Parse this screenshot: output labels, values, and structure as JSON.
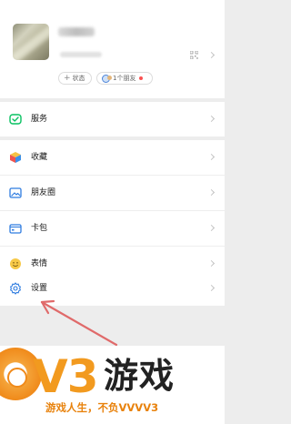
{
  "profile": {
    "status_label": "状态",
    "friends_label": "1个朋友"
  },
  "menu": {
    "services": "服务",
    "favorites": "收藏",
    "moments": "朋友圈",
    "cards": "卡包",
    "stickers": "表情",
    "settings": "设置"
  },
  "watermark": {
    "brand": "V3",
    "name": "游戏",
    "slogan": "游戏人生，不负VVVV3"
  },
  "colors": {
    "accent_green": "#07c160",
    "brand_orange": "#f29a1f",
    "arrow_red": "#e06a6a",
    "notification_red": "#fa5151"
  },
  "icons": {
    "services": "wechat-pay-check-icon",
    "favorites": "cube-icon",
    "moments": "image-icon",
    "cards": "wallet-icon",
    "stickers": "smiley-icon",
    "settings": "gear-icon",
    "qr": "qr-code-icon"
  }
}
